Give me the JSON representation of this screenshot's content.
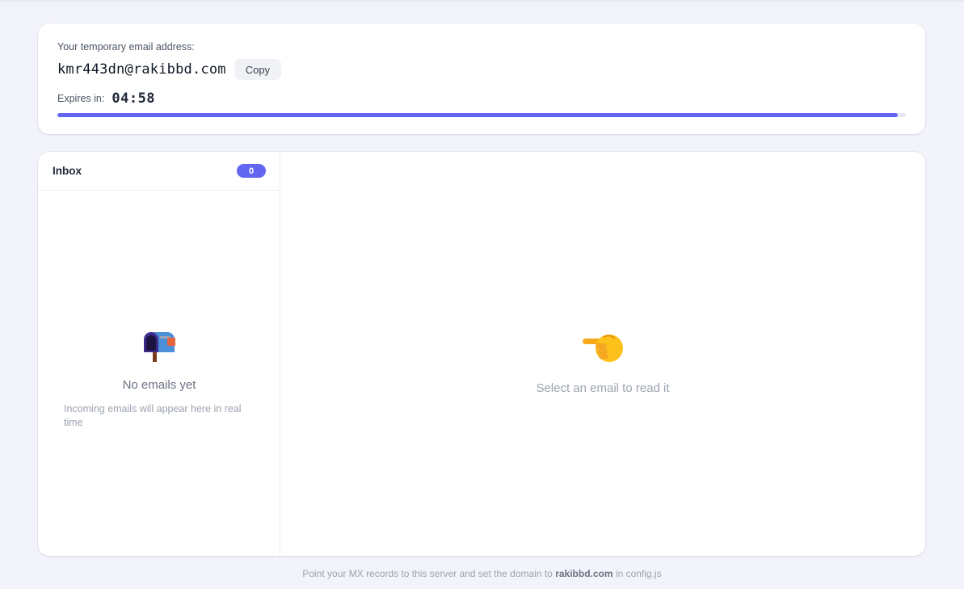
{
  "address_card": {
    "label": "Your temporary email address:",
    "email": "kmr443dn@rakibbd.com",
    "copy_label": "Copy",
    "expires_label": "Expires in:",
    "expires_time": "04:58",
    "progress_fraction": 0.99,
    "accent_color": "#6366f1"
  },
  "inbox": {
    "title": "Inbox",
    "count": "0",
    "empty_icon": "mailbox-icon",
    "empty_title": "No emails yet",
    "empty_subtitle": "Incoming emails will appear here in real time"
  },
  "reader": {
    "icon": "pointing-hand-icon",
    "placeholder": "Select an email to read it"
  },
  "footer": {
    "prefix": "Point your MX records to this server and set the domain to",
    "domain": "rakibbd.com",
    "suffix": "in config.js"
  }
}
